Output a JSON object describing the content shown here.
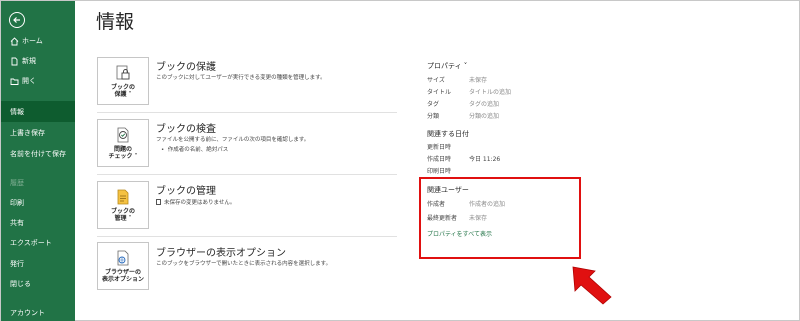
{
  "sidebar": {
    "back_label": "",
    "items": [
      {
        "label": "ホーム",
        "icon": "home-icon"
      },
      {
        "label": "新規",
        "icon": "new-file-icon"
      },
      {
        "label": "開く",
        "icon": "open-folder-icon"
      },
      {
        "label": "情報"
      },
      {
        "label": "上書き保存"
      },
      {
        "label": "名前を付けて保存"
      },
      {
        "label": "履歴"
      },
      {
        "label": "印刷"
      },
      {
        "label": "共有"
      },
      {
        "label": "エクスポート"
      },
      {
        "label": "発行"
      },
      {
        "label": "閉じる"
      },
      {
        "label": "アカウント"
      }
    ]
  },
  "main": {
    "title": "情報",
    "sections": [
      {
        "button_label_1": "ブックの",
        "button_label_2": "保護 ˅",
        "title": "ブックの保護",
        "description": "このブックに対してユーザーが実行できる変更の種類を管理します。",
        "icon": "lock-icon"
      },
      {
        "button_label_1": "問題の",
        "button_label_2": "チェック ˅",
        "title": "ブックの検査",
        "description": "ファイルを公開する前に、ファイルの次の項目を確認します。",
        "bullet": "作成者の名前、絶対パス",
        "icon": "inspect-icon"
      },
      {
        "button_label_1": "ブックの",
        "button_label_2": "管理 ˅",
        "title": "ブックの管理",
        "description": "未保存の変更はありません。",
        "icon": "manage-workbook-icon"
      },
      {
        "button_label_1": "ブラウザーの",
        "button_label_2": "表示オプション",
        "title": "ブラウザーの表示オプション",
        "description": "このブックをブラウザーで開いたときに表示される内容を選択します。",
        "icon": "browser-view-icon"
      }
    ]
  },
  "properties": {
    "heading": "プロパティ ˅",
    "rows": [
      {
        "label": "サイズ",
        "value": "未保存"
      },
      {
        "label": "タイトル",
        "value": "タイトルの追加"
      },
      {
        "label": "タグ",
        "value": "タグの追加"
      },
      {
        "label": "分類",
        "value": "分類の追加"
      }
    ],
    "dates_heading": "関連する日付",
    "dates": [
      {
        "label": "更新日時",
        "value": ""
      },
      {
        "label": "作成日時",
        "value": "今日 11:26"
      },
      {
        "label": "印刷日時",
        "value": ""
      }
    ],
    "people_heading": "関連ユーザー",
    "people": [
      {
        "label": "作成者",
        "value": "作成者の追加"
      },
      {
        "label": "最終更新者",
        "value": "未保存"
      }
    ],
    "show_all": "プロパティをすべて表示"
  },
  "colors": {
    "sidebar": "#217346",
    "sidebar_active": "#0e5c2f",
    "highlight_border": "#e01010",
    "arrow": "#e01010"
  }
}
